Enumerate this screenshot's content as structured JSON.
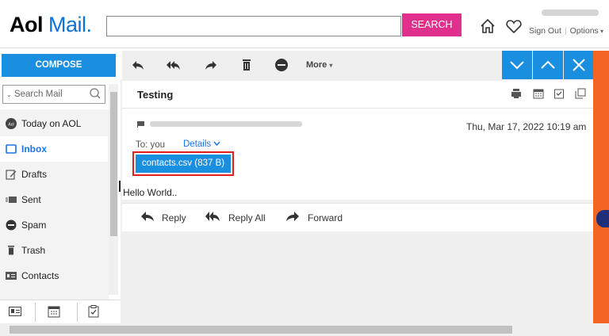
{
  "header": {
    "logo_main": "Aol",
    "logo_suffix": "Mail.",
    "search_placeholder": "",
    "search_button": "SEARCH",
    "sign_out": "Sign Out",
    "options": "Options"
  },
  "toolbar": {
    "compose": "COMPOSE",
    "more": "More"
  },
  "sidebar": {
    "search_placeholder": "Search Mail",
    "items": [
      {
        "label": "Today on AOL",
        "icon": "aol-icon"
      },
      {
        "label": "Inbox",
        "icon": "inbox-icon",
        "selected": true
      },
      {
        "label": "Drafts",
        "icon": "drafts-icon"
      },
      {
        "label": "Sent",
        "icon": "sent-icon"
      },
      {
        "label": "Spam",
        "icon": "spam-icon"
      },
      {
        "label": "Trash",
        "icon": "trash-icon"
      },
      {
        "label": "Contacts",
        "icon": "contacts-icon"
      }
    ]
  },
  "message": {
    "subject": "Testing",
    "date": "Thu, Mar 17, 2022 10:19 am",
    "to": "To: you",
    "details": "Details",
    "attachment": "contacts.csv (837 B)",
    "body": "Hello World.."
  },
  "actions": {
    "reply": "Reply",
    "reply_all": "Reply All",
    "forward": "Forward"
  },
  "colors": {
    "accent": "#1a8fe0",
    "search_button": "#e02f8d",
    "highlight": "#e0201b",
    "ad": "#f26522"
  }
}
